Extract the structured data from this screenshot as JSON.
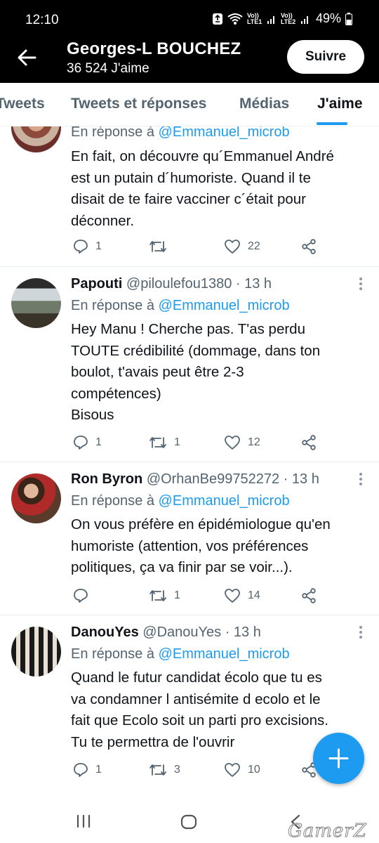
{
  "status_bar": {
    "time": "12:10",
    "volte1": "Vo)) LTE1",
    "volte2": "Vo)) LTE2",
    "battery": "49%"
  },
  "header": {
    "title": "Georges-L BOUCHEZ",
    "subtitle": "36 524 J'aime",
    "follow_label": "Suivre",
    "background_color": "#000000"
  },
  "tabs": [
    {
      "label": "Tweets"
    },
    {
      "label": "Tweets et réponses"
    },
    {
      "label": "Médias"
    },
    {
      "label": "J'aime",
      "active": true
    }
  ],
  "accent_color": "#1d9bf0",
  "tweets": [
    {
      "avatar": "avatar-partial",
      "reply_prefix": "En réponse à",
      "reply_handle": "@Emmanuel_microb",
      "lines": [
        "En fait, on découvre qu´Emmanuel André",
        "est un putain d´humoriste. Quand il te",
        "disait de te faire vacciner c´était pour",
        "déconner."
      ],
      "replies": "1",
      "retweets": "",
      "likes": "22"
    },
    {
      "name": "Papouti",
      "meta": "@piloulefou1380 · 13 h",
      "reply_prefix": "En réponse à",
      "reply_handle": "@Emmanuel_microb",
      "lines": [
        "Hey Manu ! Cherche pas. T'as perdu",
        "TOUTE crédibilité (dommage, dans ton",
        "boulot, t'avais peut être 2-3",
        "compétences)",
        "Bisous"
      ],
      "replies": "1",
      "retweets": "1",
      "likes": "12"
    },
    {
      "name": "Ron Byron",
      "meta": "@OrhanBe99752272 · 13 h",
      "reply_prefix": "En réponse à",
      "reply_handle": "@Emmanuel_microb",
      "lines": [
        "On vous préfère en épidémiologue qu'en",
        "humoriste (attention, vos préférences",
        "politiques, ça va finir par se voir...)."
      ],
      "replies": "",
      "retweets": "1",
      "likes": "14"
    },
    {
      "name": "DanouYes",
      "meta": "@DanouYes · 13 h",
      "reply_prefix": "En réponse à",
      "reply_handle": "@Emmanuel_microb",
      "lines": [
        "Quand le futur candidat écolo  que tu es",
        "va condamner l antisémite d ecolo et le",
        "fait que Ecolo soit un parti pro excisions.",
        "Tu te permettra de l'ouvrir"
      ],
      "replies": "1",
      "retweets": "3",
      "likes": "10"
    }
  ],
  "watermark": "GamerZ"
}
